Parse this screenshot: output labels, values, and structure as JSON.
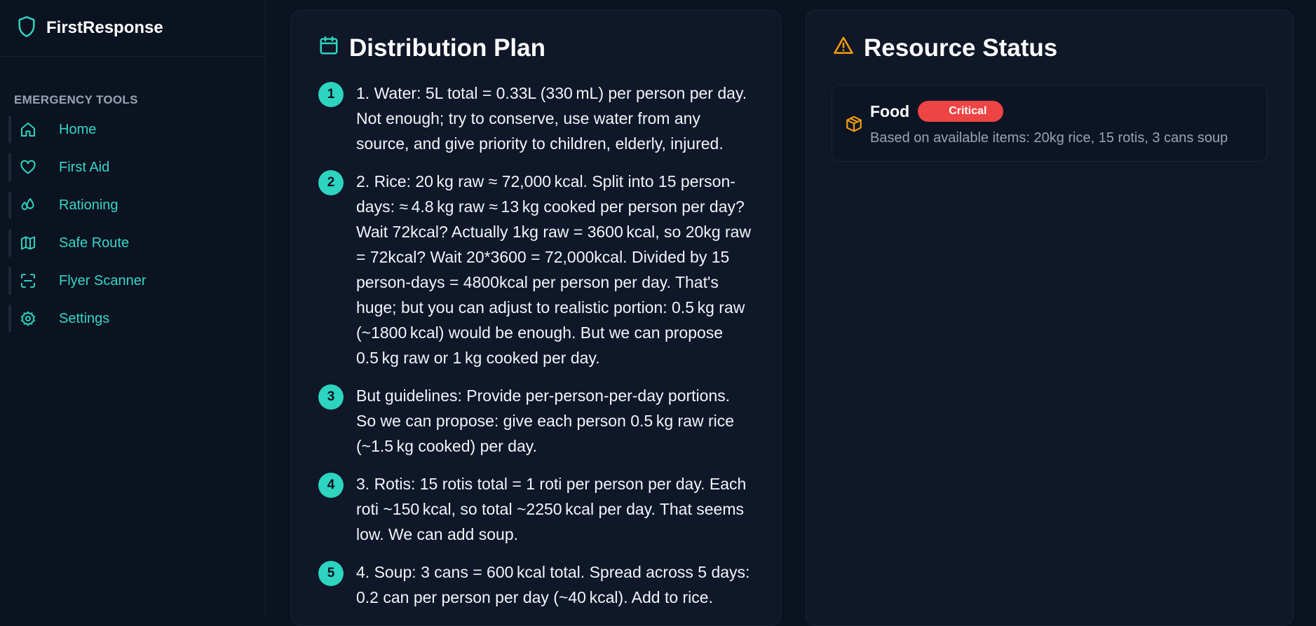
{
  "app": {
    "name": "FirstResponse"
  },
  "sidebar": {
    "section_label": "EMERGENCY TOOLS",
    "items": [
      {
        "label": "Home",
        "icon": "home-icon"
      },
      {
        "label": "First Aid",
        "icon": "heart-icon"
      },
      {
        "label": "Rationing",
        "icon": "droplets-icon"
      },
      {
        "label": "Safe Route",
        "icon": "map-icon"
      },
      {
        "label": "Flyer Scanner",
        "icon": "scan-icon"
      },
      {
        "label": "Settings",
        "icon": "gear-icon"
      }
    ]
  },
  "plan": {
    "title": "Distribution Plan",
    "icon": "calendar-icon",
    "steps": [
      {
        "num": "1",
        "text": "1. Water: 5L total = 0.33L (330 mL) per person per day. Not enough; try to conserve, use water from any source, and give priority to children, elderly, injured."
      },
      {
        "num": "2",
        "text": "2. Rice: 20 kg raw ≈ 72,000 kcal. Split into 15 person-days: ≈ 4.8 kg raw ≈ 13 kg cooked per person per day? Wait 72kcal? Actually 1kg raw = 3600 kcal, so 20kg raw = 72kcal? Wait 20*3600 = 72,000kcal. Divided by 15 person-days = 4800kcal per person per day. That's huge; but you can adjust to realistic portion: 0.5 kg raw (~1800 kcal) would be enough. But we can propose 0.5 kg raw or 1 kg cooked per day."
      },
      {
        "num": "3",
        "text": "But guidelines: Provide per-person-per-day portions. So we can propose: give each person 0.5 kg raw rice (~1.5 kg cooked) per day."
      },
      {
        "num": "4",
        "text": "3. Rotis: 15 rotis total = 1 roti per person per day. Each roti ~150 kcal, so total ~2250 kcal per day. That seems low. We can add soup."
      },
      {
        "num": "5",
        "text": "4. Soup: 3 cans = 600 kcal total. Spread across 5 days: 0.2 can per person per day (~40 kcal). Add to rice."
      }
    ]
  },
  "status": {
    "title": "Resource Status",
    "icon": "warning-icon",
    "resources": [
      {
        "name": "Food",
        "badge": "Critical",
        "badge_color": "#ef4444",
        "icon": "package-icon",
        "description": "Based on available items: 20kg rice, 15 rotis, 3 cans soup"
      }
    ]
  },
  "colors": {
    "accent": "#2dd4bf",
    "warning": "#f59e0b",
    "critical": "#ef4444",
    "background": "#0b1220"
  }
}
